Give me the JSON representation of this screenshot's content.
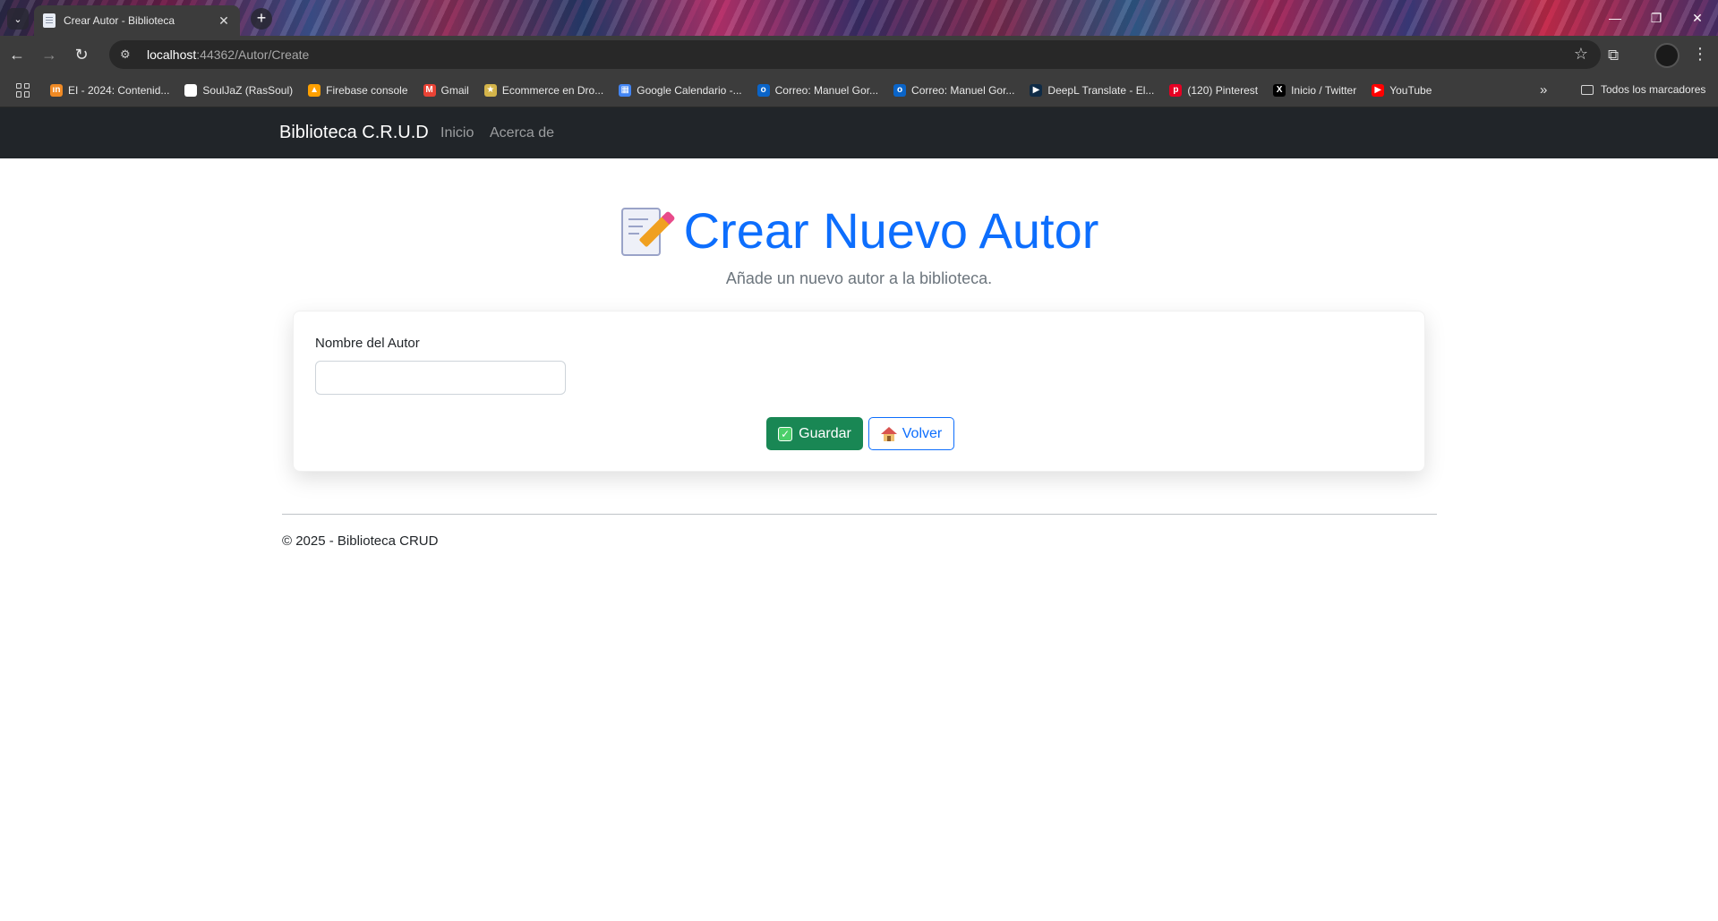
{
  "browser": {
    "tab_title": "Crear Autor - Biblioteca",
    "url_host": "localhost",
    "url_rest": ":44362/Autor/Create",
    "bookmarks": [
      {
        "label": "EI - 2024: Contenid...",
        "icon": "flag-icon",
        "color": "#f08a24"
      },
      {
        "label": "SoulJaZ (RasSoul)",
        "icon": "github-icon",
        "color": "#ffffff"
      },
      {
        "label": "Firebase console",
        "icon": "firebase-icon",
        "color": "#ffa000"
      },
      {
        "label": "Gmail",
        "icon": "gmail-icon",
        "color": "#ea4335"
      },
      {
        "label": "Ecommerce en Dro...",
        "icon": "ecommerce-icon",
        "color": "#d4b44a"
      },
      {
        "label": "Google Calendario -...",
        "icon": "calendar-icon",
        "color": "#4285f4"
      },
      {
        "label": "Correo: Manuel Gor...",
        "icon": "outlook-icon",
        "color": "#0a64c8"
      },
      {
        "label": "Correo: Manuel Gor...",
        "icon": "outlook-icon",
        "color": "#0a64c8"
      },
      {
        "label": "DeepL Translate - El...",
        "icon": "deepl-icon",
        "color": "#0f2b46"
      },
      {
        "label": "(120) Pinterest",
        "icon": "pinterest-icon",
        "color": "#e60023"
      },
      {
        "label": "Inicio / Twitter",
        "icon": "x-icon",
        "color": "#000000"
      },
      {
        "label": "YouTube",
        "icon": "youtube-icon",
        "color": "#ff0000"
      }
    ],
    "all_bookmarks_label": "Todos los marcadores"
  },
  "navbar": {
    "brand": "Biblioteca C.R.U.D",
    "links": [
      "Inicio",
      "Acerca de"
    ]
  },
  "page": {
    "title": "Crear Nuevo Autor",
    "subtitle": "Añade un nuevo autor a la biblioteca."
  },
  "form": {
    "name_label": "Nombre del Autor",
    "name_value": "",
    "save_label": "Guardar",
    "back_label": "Volver"
  },
  "footer": {
    "text": "© 2025 - Biblioteca CRUD"
  },
  "colors": {
    "primary": "#0d6efd",
    "success": "#198754",
    "navbar_bg": "#212529"
  }
}
